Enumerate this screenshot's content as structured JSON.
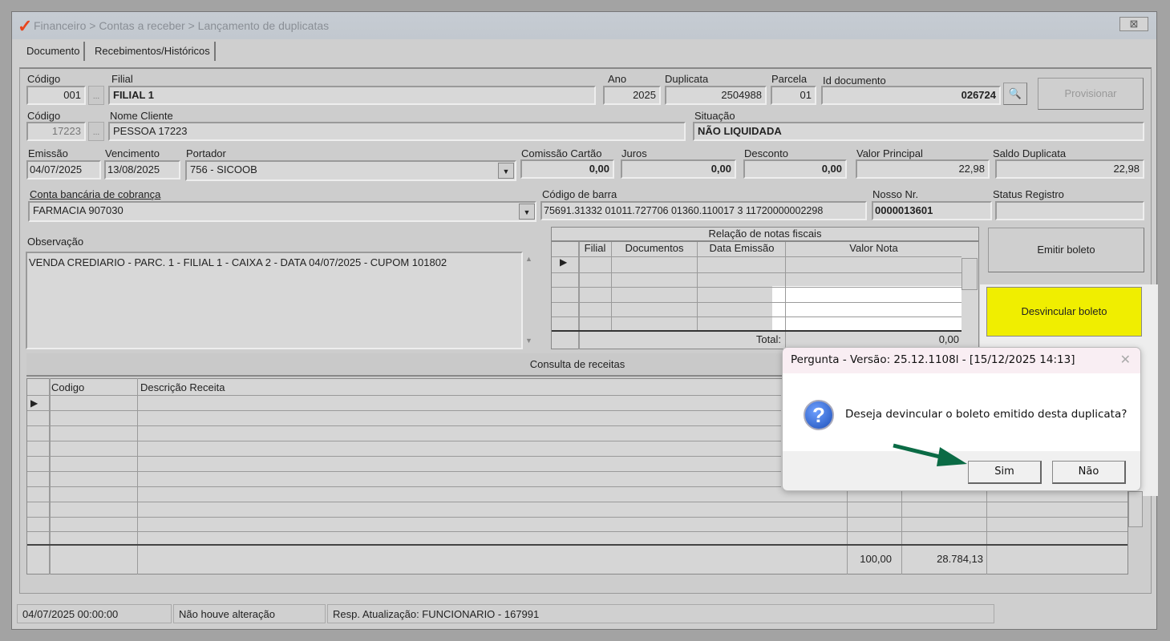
{
  "window": {
    "title": "Financeiro > Contas a receber > Lançamento de duplicatas",
    "close": "⊠"
  },
  "tabs": [
    {
      "label": "Documento"
    },
    {
      "label": "Recebimentos/Históricos"
    }
  ],
  "form": {
    "codigo_filial": {
      "label": "Código",
      "value": "001"
    },
    "filial": {
      "label": "Filial",
      "value": "FILIAL 1"
    },
    "ano": {
      "label": "Ano",
      "value": "2025"
    },
    "duplicata": {
      "label": "Duplicata",
      "value": "2504988"
    },
    "parcela": {
      "label": "Parcela",
      "value": "01"
    },
    "id_documento": {
      "label": "Id documento",
      "value": "026724"
    },
    "provisionar": "Provisionar",
    "codigo_cliente": {
      "label": "Código",
      "value": "17223"
    },
    "nome_cliente": {
      "label": "Nome Cliente",
      "value": "PESSOA 17223"
    },
    "situacao": {
      "label": "Situação",
      "value": "NÃO LIQUIDADA"
    },
    "emissao": {
      "label": "Emissão",
      "value": "04/07/2025"
    },
    "vencimento": {
      "label": "Vencimento",
      "value": "13/08/2025"
    },
    "portador": {
      "label": "Portador",
      "value": "756 - SICOOB"
    },
    "comissao": {
      "label": "Comissão Cartão",
      "value": "0,00"
    },
    "juros": {
      "label": "Juros",
      "value": "0,00"
    },
    "desconto": {
      "label": "Desconto",
      "value": "0,00"
    },
    "valor_principal": {
      "label": "Valor Principal",
      "value": "22,98"
    },
    "saldo": {
      "label": "Saldo Duplicata",
      "value": "22,98"
    },
    "conta": {
      "label": "Conta bancária de cobrança",
      "value": "FARMACIA 907030"
    },
    "codigo_barra": {
      "label": "Código de barra",
      "value": "75691.31332 01011.727706 01360.110017 3 11720000002298"
    },
    "nosso_nr": {
      "label": "Nosso Nr.",
      "value": "0000013601"
    },
    "status_registro": {
      "label": "Status Registro",
      "value": ""
    },
    "observacao": {
      "label": "Observação",
      "value": "VENDA CREDIARIO - PARC. 1 - FILIAL 1 - CAIXA 2 - DATA 04/07/2025 - CUPOM 101802"
    }
  },
  "notas": {
    "title": "Relação de notas fiscais",
    "columns": [
      "Filial",
      "Documentos",
      "Data Emissão",
      "Valor Nota"
    ],
    "total_label": "Total:",
    "total": "0,00"
  },
  "buttons": {
    "emitir": "Emitir boleto",
    "desvincular": "Desvincular boleto"
  },
  "colors": {
    "desvincular": "#f0ee00",
    "dialog_title": "#f9eef3"
  },
  "receitas": {
    "title": "Consulta de receitas",
    "columns": [
      "Codigo",
      "Descrição Receita"
    ],
    "footer": [
      "100,00",
      "28.784,13"
    ]
  },
  "statusbar": [
    "04/07/2025 00:00:00",
    "Não houve alteração",
    "Resp. Atualização: FUNCIONARIO - 167991"
  ],
  "dialog": {
    "title": "Pergunta - Versão: 25.12.1108l - [15/12/2025 14:13]",
    "message": "Deseja devincular o boleto emitido desta duplicata?",
    "yes": "Sim",
    "no": "Não",
    "close": "✕"
  }
}
